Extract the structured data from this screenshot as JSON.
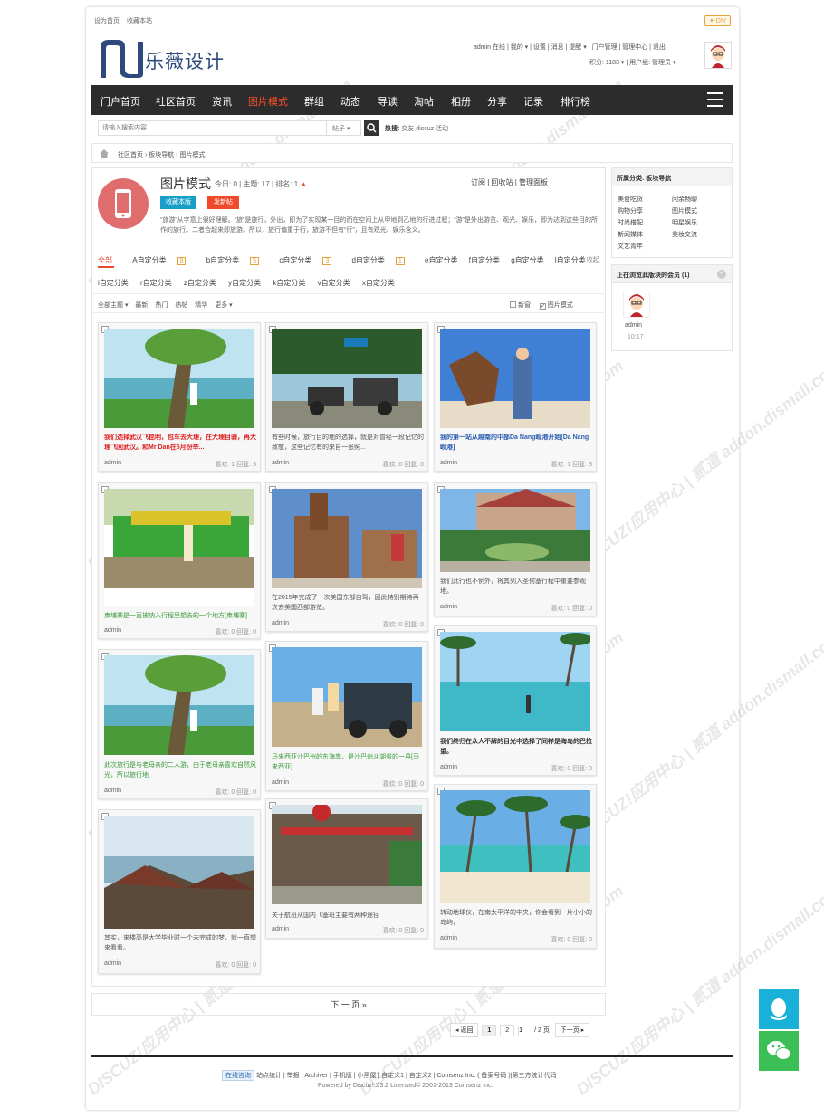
{
  "top": {
    "set_home": "设为首页",
    "bookmark": "收藏本站",
    "diy": "✦ DIY"
  },
  "site": {
    "logo_text": "乐薇设计"
  },
  "user": {
    "line1": "admin 在线 | 我的 ▾ | 设置 | 消息 | 提醒 ▾ | 门户管理 | 管理中心 | 退出",
    "line2": "积分: 1183 ▾ | 用户组: 管理员 ▾"
  },
  "nav": [
    "门户首页",
    "社区首页",
    "资讯",
    "图片模式",
    "群组",
    "动态",
    "导读",
    "淘帖",
    "相册",
    "分享",
    "记录",
    "排行榜"
  ],
  "search": {
    "placeholder": "请输入搜索内容",
    "type": "帖子 ▾",
    "hot_label": "热搜:",
    "hot_terms": "交友 discuz 活动"
  },
  "breadcrumb": "社区首页 › 板块导航 › 图片模式",
  "forum": {
    "title": "图片模式",
    "stats": "今日: 0 | 主题: 17 | 排名: 1",
    "fav_btn": "收藏本版",
    "post_btn": "发新帖",
    "tools": "订阅 | 回收站 | 管理面板",
    "desc": "“旅游”从字意上很好理解。“旅”是旅行，外出，即为了实现某一目的而在空间上从甲地到乙地的行进过程；“游”是外出游览、观光、娱乐，即为达到这些目的所作的旅行。二者合起来即旅游。所以，旅行偏重于行，旅游不但有“行”，且有观光、娱乐含义。"
  },
  "tabs_row1": [
    {
      "label": "全部",
      "count": ""
    },
    {
      "label": "A自定分类",
      "count": "8"
    },
    {
      "label": "b自定分类",
      "count": "5"
    },
    {
      "label": "c自定分类",
      "count": "3"
    },
    {
      "label": "d自定分类",
      "count": "1"
    },
    {
      "label": "e自定分类",
      "count": ""
    },
    {
      "label": "f自定分类",
      "count": ""
    },
    {
      "label": "g自定分类",
      "count": ""
    },
    {
      "label": "l自定分类",
      "count": ""
    }
  ],
  "collapse": "⌃ 收起",
  "tabs_row2": [
    "i自定分类",
    "r自定分类",
    "z自定分类",
    "y自定分类",
    "k自定分类",
    "v自定分类",
    "x自定分类"
  ],
  "filter": {
    "left": [
      "全部主题 ▾",
      "最新",
      "热门",
      "热帖",
      "精华",
      "更多 ▾"
    ],
    "new_window": "新窗",
    "pic_mode": "图片模式"
  },
  "cards": [
    {
      "title": "我们选择武汉飞昆明，包车去大理，在大理目骑，再大理飞回武汉。和Mr Dan在5月份举...",
      "color": "#e02020",
      "author": "admin",
      "stats": "喜欢: 1   回复: 3"
    },
    {
      "title": "有些时候，旅行目的地的选择，就是对曾经一段记忆的致敬，这些记忆有的来自一张照...",
      "color": "#555",
      "author": "admin",
      "stats": "喜欢: 0   回复: 0"
    },
    {
      "title": "我的第一站从越南的中部Da Nang岘港开始[Da Nang岘港]",
      "color": "#2a5db0",
      "author": "admin",
      "stats": "喜欢: 1   回复: 3"
    },
    {
      "title": "柬埔寨是一直被纳入行程里想去的一个地方[柬埔寨]",
      "color": "#3a9a3a",
      "author": "admin",
      "stats": "喜欢: 0   回复: 0"
    },
    {
      "title": "在2015年完成了一次美国东部自驾，因此特别期待再次去美国西部游览。",
      "color": "#555",
      "author": "admin",
      "stats": "喜欢: 0   回复: 0"
    },
    {
      "title": "我们此行也不例外，将其列入圣何塞行程中重要参观地。",
      "color": "#555",
      "author": "admin",
      "stats": "喜欢: 0   回复: 0"
    },
    {
      "title": "此次旅行是与老母亲的二人游，由于老母亲喜欢自然风光，所以旅行地",
      "color": "#3a9a3a",
      "author": "admin",
      "stats": "喜欢: 0   回复: 0"
    },
    {
      "title": "马来西亚沙巴州的东海岸，是沙巴州斗湖省的一县[马来西亚]",
      "color": "#3a9a3a",
      "author": "admin",
      "stats": "喜欢: 0   回复: 0"
    },
    {
      "title": "我们终归在众人不解的目光中选择了同样是海岛的巴拉望。",
      "color": "#333",
      "author": "admin",
      "stats": "喜欢: 0   回复: 0"
    },
    {
      "title": "其实，来楼高是大学毕业时一个未完成的梦，就一直想来看看。",
      "color": "#555",
      "author": "admin",
      "stats": "喜欢: 0   回复: 0"
    },
    {
      "title": "关于航班从国内飞塞班主要有两种途径",
      "color": "#555",
      "author": "admin",
      "stats": "喜欢: 0   回复: 0"
    },
    {
      "title": "转动地球仪，在南太平洋的中央，你会看到一片小小的岛屿，",
      "color": "#555",
      "author": "admin",
      "stats": "喜欢: 0   回复: 0"
    }
  ],
  "next_page": "下 一 页 »",
  "pager": {
    "prev": "◂ 返回",
    "p1": "1",
    "p2": "2",
    "total": "/ 2 页",
    "next": "下一页 ▸",
    "input": "1"
  },
  "sidebar": {
    "nav_title": "所属分类: 板块导航",
    "links": [
      "美食吃货",
      "闲余畅聊",
      "购物分享",
      "图片模式",
      "时尚搭配",
      "明星娱乐",
      "新闻媒体",
      "美妆交流",
      "文艺青年"
    ],
    "browsing_title": "正在浏览此版块的会员 (1)",
    "member_name": "admin",
    "member_time": "10:17"
  },
  "footer": {
    "online": "在线咨询",
    "links": "站点统计 | 举报 | Archiver | 手机版 | 小黑屋 | 自定义1 | 自定义2 | Comsenz Inc. ( 备案号码 )|第三方统计代码",
    "powered": "Powered by Discuz! X3.2 Licensed© 2001-2013 Comsenz Inc."
  },
  "watermark": "DISCUZ!应用中心 | 贰道  addon.dismall.com"
}
